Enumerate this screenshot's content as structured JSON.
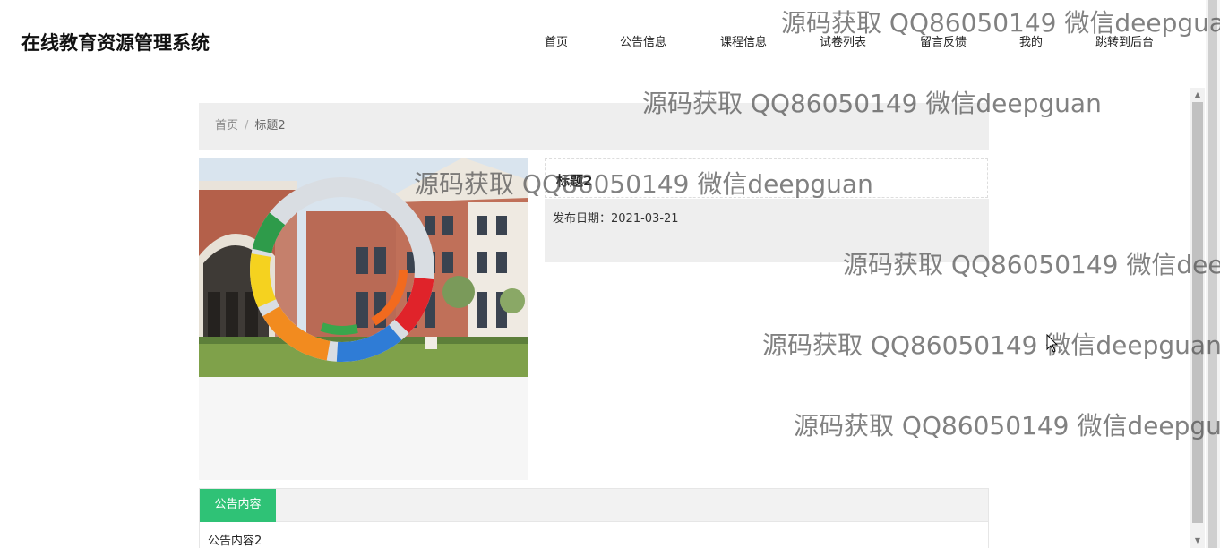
{
  "header": {
    "site_title": "在线教育资源管理系统",
    "nav": [
      {
        "label": "首页"
      },
      {
        "label": "公告信息"
      },
      {
        "label": "课程信息"
      },
      {
        "label": "试卷列表"
      },
      {
        "label": "留言反馈"
      },
      {
        "label": "我的"
      },
      {
        "label": "跳转到后台"
      }
    ]
  },
  "breadcrumb": {
    "home": "首页",
    "separator": "/",
    "current": "标题2"
  },
  "detail": {
    "image_icon": "campus-sculpture-photo",
    "title": "标题2",
    "publish_date_label": "发布日期：",
    "publish_date": "2021-03-21"
  },
  "content": {
    "tab_label": "公告内容",
    "text": "公告内容2"
  },
  "watermark": {
    "text": "源码获取 QQ86050149 微信deepguan"
  },
  "colors": {
    "accent_green": "#2fc276",
    "panel_gray": "#eeeeee"
  }
}
